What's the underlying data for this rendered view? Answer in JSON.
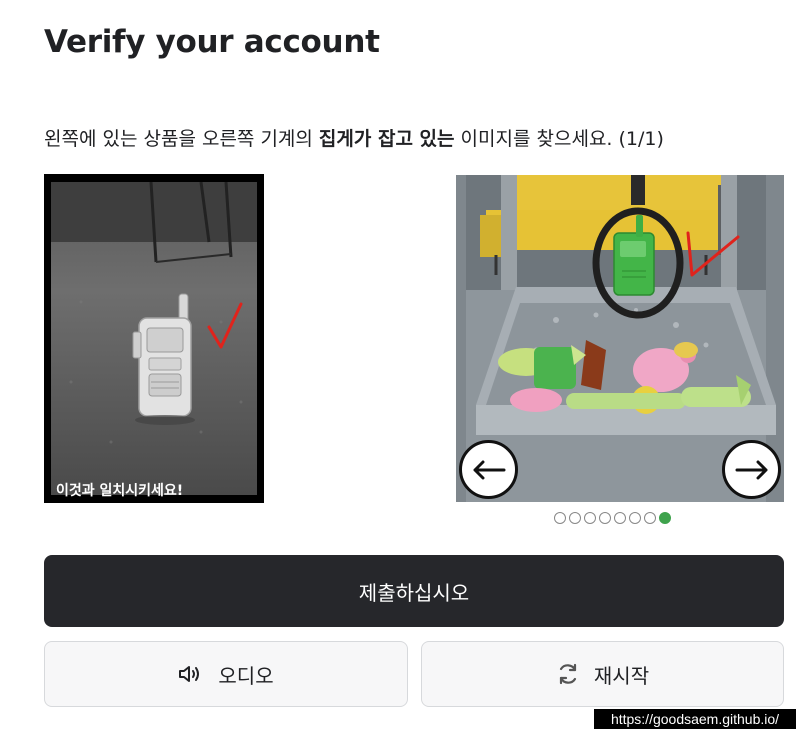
{
  "header": {
    "title": "Verify your account"
  },
  "instruction": {
    "prefix": "왼쪽에 있는 상품을 오른쪽 기계의 ",
    "emphasis": "집게가 잡고 있는",
    "suffix": " 이미지를 찾으세요. (1/1)"
  },
  "reference_image": {
    "caption": "이것과 일치시키세요!"
  },
  "carousel": {
    "prev_icon": "arrow-left-icon",
    "next_icon": "arrow-right-icon",
    "page_count": 8,
    "active_index": 7
  },
  "buttons": {
    "submit_label": "제출하십시오",
    "audio_label": "오디오",
    "audio_icon": "speaker-icon",
    "restart_label": "재시작",
    "restart_icon": "refresh-icon"
  },
  "footer": {
    "url": "https://goodsaem.github.io/"
  },
  "colors": {
    "submit_bg": "#26272b",
    "active_dot": "#3fa34d",
    "annotation_red": "#e0231c"
  }
}
